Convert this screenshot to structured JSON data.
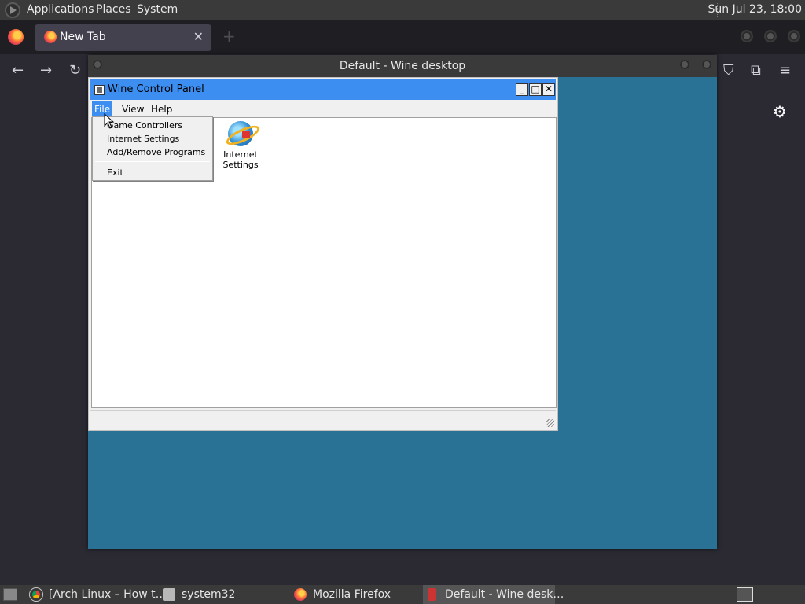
{
  "top_panel": {
    "menus": [
      "Applications",
      "Places",
      "System"
    ],
    "clock": "Sun Jul 23, 18:00"
  },
  "firefox": {
    "tab_title": "New Tab",
    "close_glyph": "✕",
    "newtab_glyph": "+",
    "back_glyph": "←",
    "forward_glyph": "→",
    "reload_glyph": "↻",
    "pocket_glyph": "⛉",
    "extensions_glyph": "⧉",
    "menu_glyph": "≡",
    "gear_glyph": "⚙"
  },
  "wine_desktop": {
    "title": "Default - Wine desktop"
  },
  "control_panel": {
    "title": "Wine Control Panel",
    "minimize": "_",
    "maximize": "□",
    "close": "✕",
    "menus": {
      "file": "File",
      "view": "View",
      "help": "Help"
    },
    "applets": [
      {
        "label_line1": "Internet",
        "label_line2": "Settings"
      }
    ]
  },
  "file_menu": {
    "items": [
      "Game Controllers",
      "Internet Settings",
      "Add/Remove Programs"
    ],
    "exit": "Exit"
  },
  "taskbar": {
    "tasks": [
      {
        "label": "[Arch Linux – How t…"
      },
      {
        "label": "system32"
      },
      {
        "label": "Mozilla Firefox"
      },
      {
        "label": "Default - Wine desk…"
      }
    ]
  },
  "colors": {
    "wine_desktop_bg": "#2a7196",
    "titlebar_active": "#3c8ef0",
    "panel": "#3a3a3a",
    "firefox_bg": "#2b2a33"
  }
}
